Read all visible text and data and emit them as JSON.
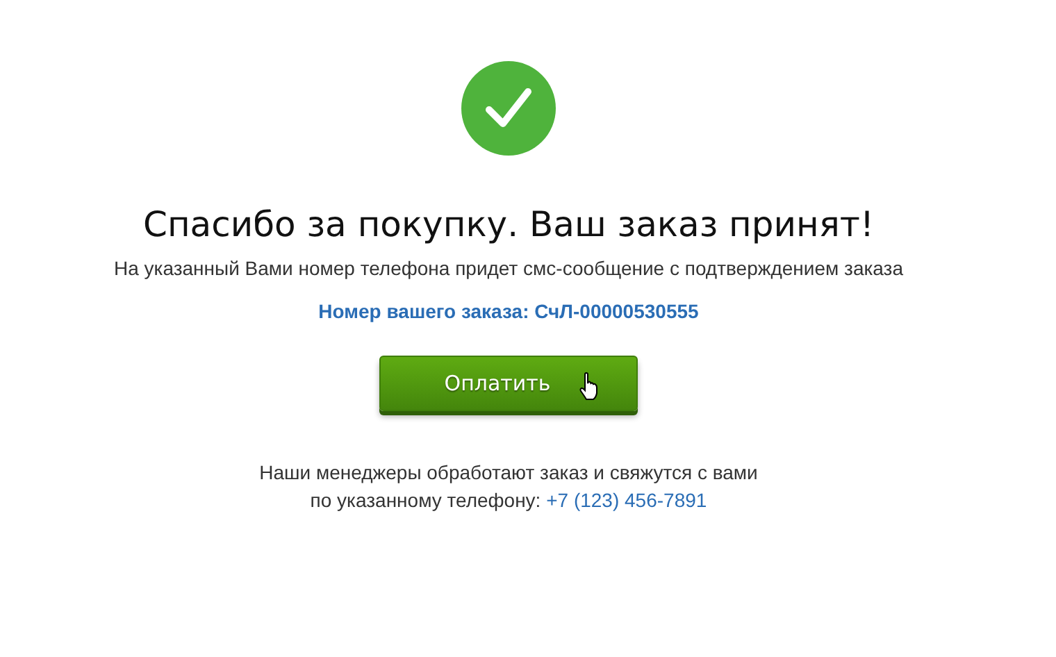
{
  "title": "Спасибо за покупку. Ваш заказ принят!",
  "subtitle": "На указанный Вами номер телефона придет смс-сообщение с подтверждением заказа",
  "order_number": "Номер вашего заказа: СчЛ-00000530555",
  "pay_button": "Оплатить",
  "footer": {
    "line_1": "Наши менеджеры обработают заказ и свяжутся с вами",
    "line_2": "по указанному телефону:",
    "phone": "+7 (123) 456-7891"
  }
}
